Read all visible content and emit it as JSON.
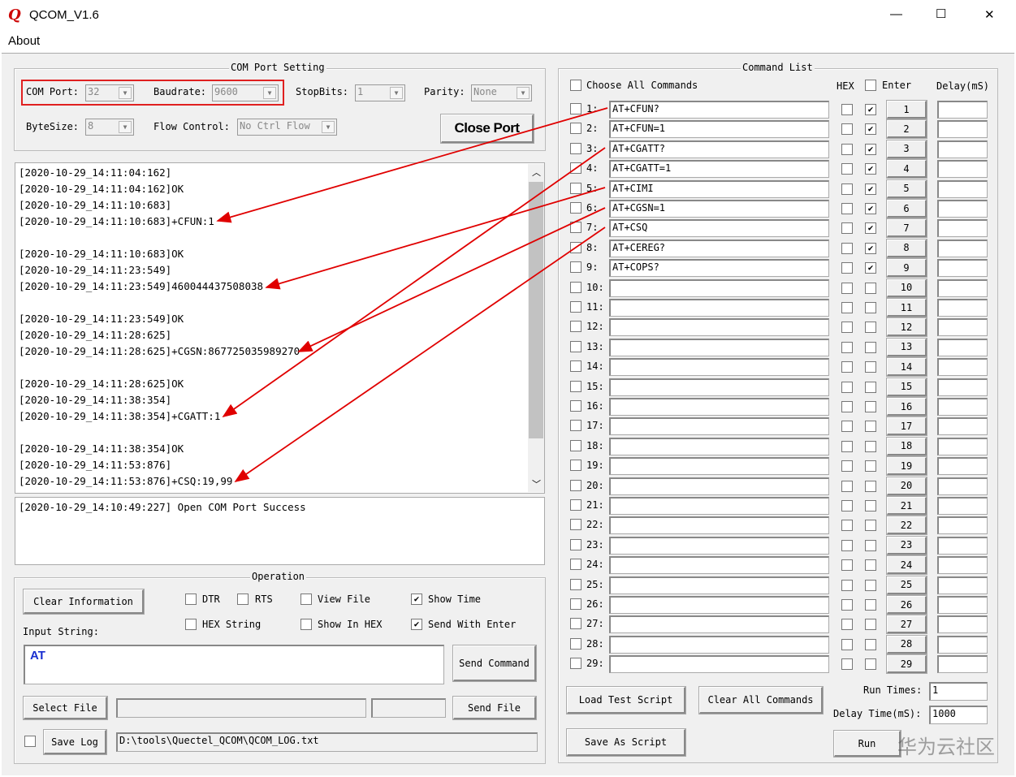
{
  "window": {
    "title": "QCOM_V1.6",
    "minimize": "—",
    "maximize": "☐",
    "close": "✕"
  },
  "menu": {
    "about": "About"
  },
  "com_setting": {
    "title": "COM Port Setting",
    "com_port_label": "COM Port:",
    "com_port": "32",
    "baudrate_label": "Baudrate:",
    "baudrate": "9600",
    "stopbits_label": "StopBits:",
    "stopbits": "1",
    "parity_label": "Parity:",
    "parity": "None",
    "bytesize_label": "ByteSize:",
    "bytesize": "8",
    "flow_label": "Flow Control:",
    "flow": "No Ctrl Flow",
    "close_port": "Close Port"
  },
  "log_lines": [
    "[2020-10-29_14:11:04:162]",
    "[2020-10-29_14:11:04:162]OK",
    "[2020-10-29_14:11:10:683]",
    "[2020-10-29_14:11:10:683]+CFUN:1",
    "",
    "[2020-10-29_14:11:10:683]OK",
    "[2020-10-29_14:11:23:549]",
    "[2020-10-29_14:11:23:549]460044437508038",
    "",
    "[2020-10-29_14:11:23:549]OK",
    "[2020-10-29_14:11:28:625]",
    "[2020-10-29_14:11:28:625]+CGSN:867725035989270",
    "",
    "[2020-10-29_14:11:28:625]OK",
    "[2020-10-29_14:11:38:354]",
    "[2020-10-29_14:11:38:354]+CGATT:1",
    "",
    "[2020-10-29_14:11:38:354]OK",
    "[2020-10-29_14:11:53:876]",
    "[2020-10-29_14:11:53:876]+CSQ:19,99"
  ],
  "status_log": "[2020-10-29_14:10:49:227] Open COM Port Success",
  "operation": {
    "title": "Operation",
    "clear_info": "Clear Information",
    "dtr": "DTR",
    "rts": "RTS",
    "view_file": "View File",
    "show_time": "Show Time",
    "hex_string": "HEX String",
    "show_in_hex": "Show In HEX",
    "send_with_enter": "Send With Enter",
    "show_time_checked": true,
    "send_with_enter_checked": true,
    "input_label": "Input String:",
    "input_value": "AT",
    "send_command": "Send Command",
    "select_file": "Select File",
    "send_file": "Send File",
    "save_log": "Save Log",
    "log_path": "D:\\tools\\Quectel_QCOM\\QCOM_LOG.txt"
  },
  "command_list": {
    "title": "Command List",
    "choose_all": "Choose All Commands",
    "hex": "HEX",
    "enter": "Enter",
    "delay": "Delay(mS)",
    "commands": [
      "AT+CFUN?",
      "AT+CFUN=1",
      "AT+CGATT?",
      "AT+CGATT=1",
      "AT+CIMI",
      "AT+CGSN=1",
      "AT+CSQ",
      "AT+CEREG?",
      "AT+COPS?",
      "",
      "",
      "",
      "",
      "",
      "",
      "",
      "",
      "",
      "",
      "",
      "",
      "",
      "",
      "",
      "",
      "",
      "",
      "",
      ""
    ],
    "enter_checked_count": 9,
    "load_script": "Load Test Script",
    "clear_all": "Clear All Commands",
    "save_script": "Save As Script",
    "run_times_label": "Run Times:",
    "run_times": "1",
    "delay_time_label": "Delay Time(mS):",
    "delay_time": "1000",
    "run": "Run"
  },
  "watermark": "华为云社区",
  "colors": {
    "annotation": "#e00000",
    "highlight_box": "#e02020",
    "input_text": "#1a2fd0"
  }
}
